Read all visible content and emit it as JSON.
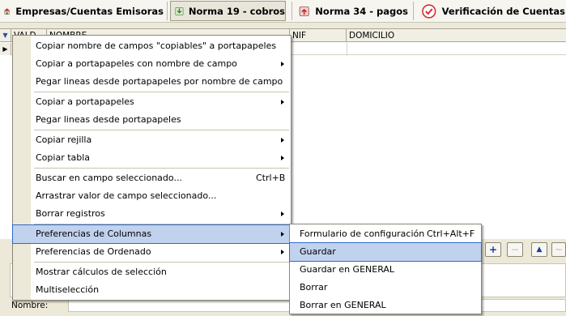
{
  "toolbar": {
    "btn1": "Empresas/Cuentas Emisoras",
    "btn2": "Norma 19 - cobros",
    "btn3": "Norma 34 - pagos",
    "btn4": "Verificación de Cuentas"
  },
  "grid": {
    "col1": "VALD",
    "col2": "NOMBRE",
    "col3": "NIF",
    "col4": "DOMICILIO"
  },
  "lower": {
    "nombre_label": "Nombre:"
  },
  "context_menu": {
    "items": [
      {
        "label": "Copiar nombre de campos \"copiables\" a portapapeles"
      },
      {
        "label": "Copiar a portapapeles con nombre de campo"
      },
      {
        "label": "Pegar lineas desde portapapeles por nombre de campo"
      },
      {
        "label": "Copiar a portapapeles"
      },
      {
        "label": "Pegar lineas desde portapapeles"
      },
      {
        "label": "Copiar rejilla"
      },
      {
        "label": "Copiar tabla"
      },
      {
        "label": "Buscar en campo seleccionado...",
        "shortcut": "Ctrl+B"
      },
      {
        "label": "Arrastrar valor de campo seleccionado..."
      },
      {
        "label": "Borrar registros"
      },
      {
        "label": "Preferencias de Columnas"
      },
      {
        "label": "Preferencias de Ordenado"
      },
      {
        "label": "Mostrar cálculos de selección"
      },
      {
        "label": "Multiselección"
      }
    ]
  },
  "submenu": {
    "items": [
      {
        "label": "Formulario de configuración",
        "shortcut": "Ctrl+Alt+F"
      },
      {
        "label": "Guardar"
      },
      {
        "label": "Guardar en GENERAL"
      },
      {
        "label": "Borrar"
      },
      {
        "label": "Borrar en GENERAL"
      }
    ]
  }
}
